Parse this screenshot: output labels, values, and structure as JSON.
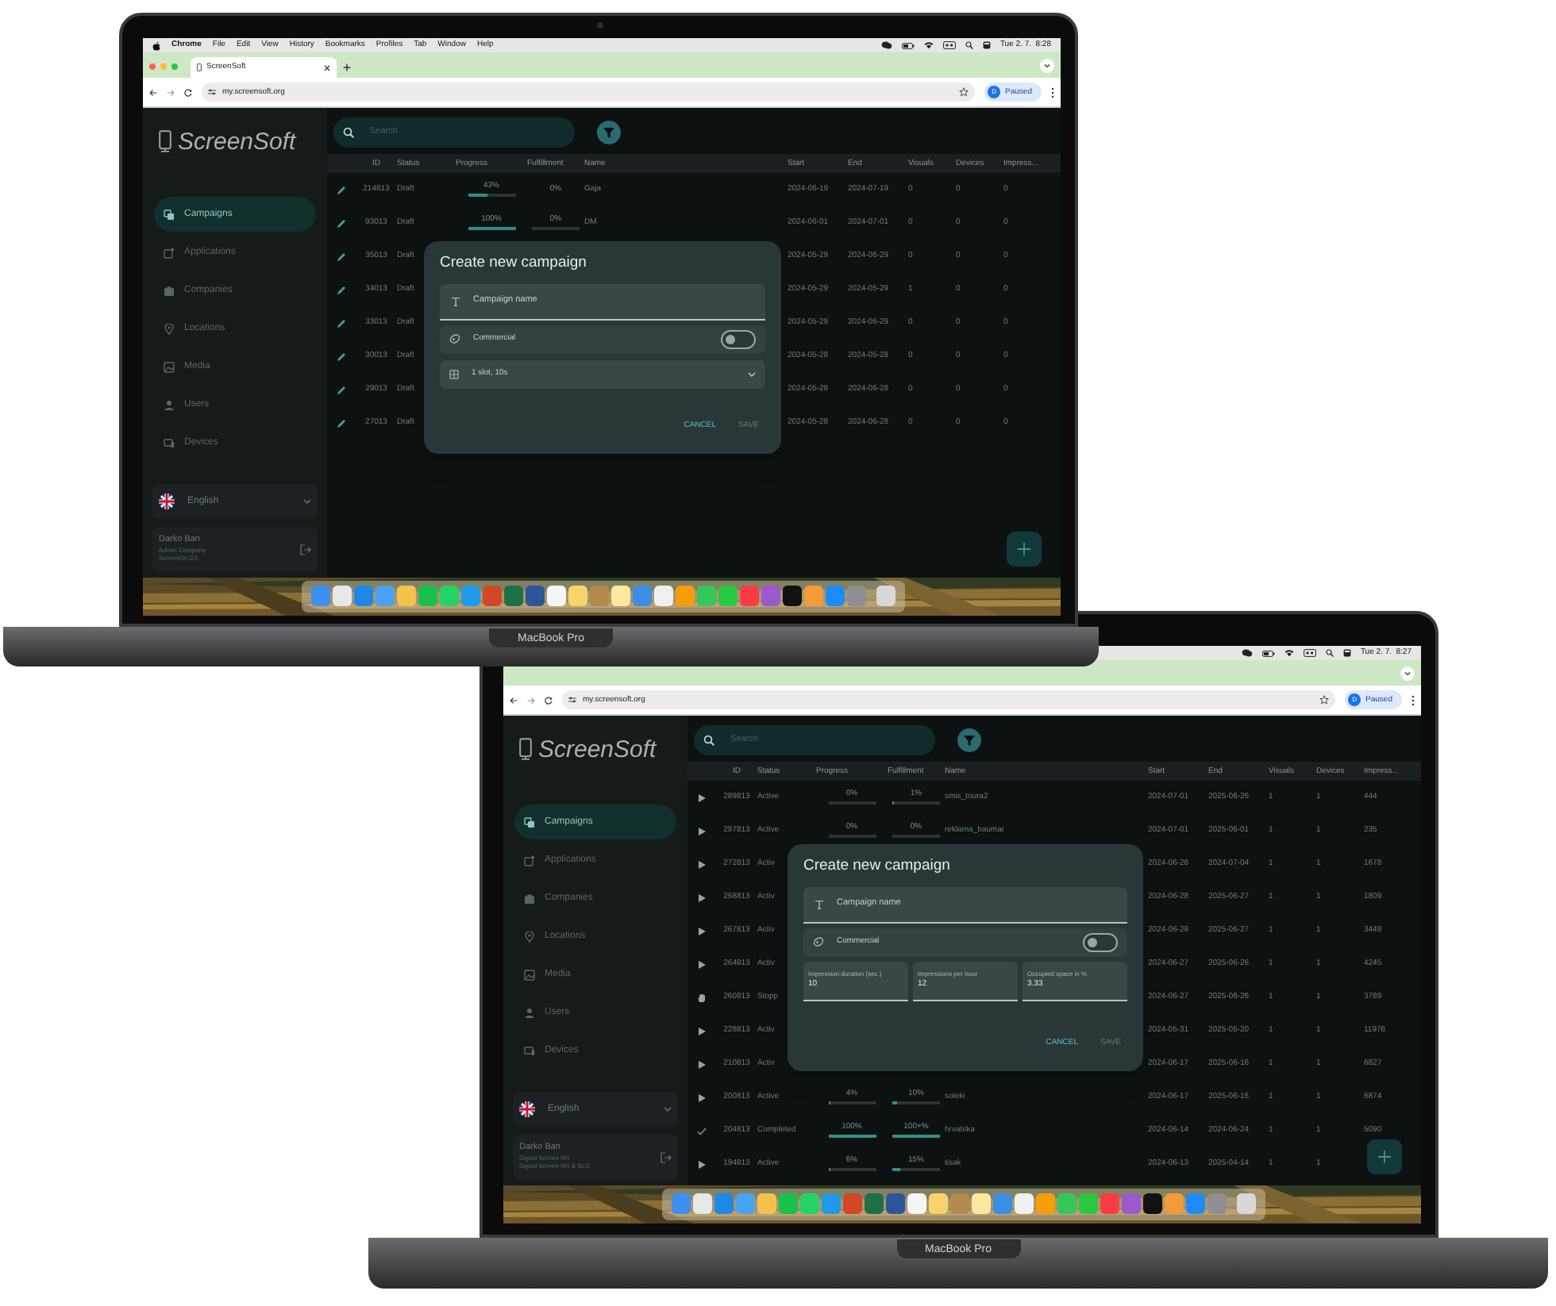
{
  "laptops": [
    {
      "menu_bar": {
        "app_menus": [
          "Chrome",
          "File",
          "Edit",
          "View",
          "History",
          "Bookmarks",
          "Profiles",
          "Tab",
          "Window",
          "Help"
        ],
        "clock": "Tue 2. 7.  8:28"
      },
      "tabs": [
        {
          "title": "ScreenSoft",
          "selected": true
        }
      ],
      "address_bar": {
        "url": "my.screensoft.org",
        "avatar": "D",
        "profile": "Paused"
      },
      "app": {
        "logo": "ScreenSoft",
        "search": {
          "placeholder": "Search"
        },
        "nav": [
          {
            "label": "Campaigns",
            "selected": true
          },
          {
            "label": "Applications",
            "selected": false
          },
          {
            "label": "Companies",
            "selected": false
          },
          {
            "label": "Locations",
            "selected": false
          },
          {
            "label": "Media",
            "selected": false
          },
          {
            "label": "Users",
            "selected": false
          },
          {
            "label": "Devices",
            "selected": false
          }
        ],
        "language": "English",
        "user": {
          "name": "Darko Ban",
          "line_2": "Admin Company",
          "line_3": "ScreenOn CX"
        },
        "table": {
          "columns": [
            "ID",
            "Status",
            "Progress",
            "Fulfillment",
            "Name",
            "Start",
            "End",
            "Visuals",
            "Devices",
            "Impress..."
          ],
          "rows": [
            {
              "kind": "draft",
              "id": "214813",
              "status": "Draft",
              "progress": {
                "text": "43%",
                "level": 0.43
              },
              "fulfillment": {
                "text": "0%"
              },
              "name": "Gaja",
              "start": "2024-06-19",
              "end": "2024-07-19",
              "visuals": "0",
              "devices": "0",
              "impressions": "0"
            },
            {
              "kind": "draft",
              "id": "93013",
              "status": "Draft",
              "progress": {
                "text": "100%",
                "level": 1
              },
              "fulfillment": {
                "text": "0%",
                "level": 0
              },
              "name": "DM",
              "start": "2024-06-01",
              "end": "2024-07-01",
              "visuals": "0",
              "devices": "0",
              "impressions": "0"
            },
            {
              "kind": "draft",
              "id": "35013",
              "status": "Draft",
              "start": "2024-05-29",
              "end": "2024-06-29",
              "visuals": "0",
              "devices": "0",
              "impressions": "0"
            },
            {
              "kind": "draft",
              "id": "34013",
              "status": "Draft",
              "start": "2024-05-29",
              "end": "2024-05-29",
              "visuals": "1",
              "devices": "0",
              "impressions": "0"
            },
            {
              "kind": "draft",
              "id": "33013",
              "status": "Draft",
              "start": "2024-05-29",
              "end": "2024-06-29",
              "visuals": "0",
              "devices": "0",
              "impressions": "0"
            },
            {
              "kind": "draft",
              "id": "30013",
              "status": "Draft",
              "start": "2024-05-28",
              "end": "2024-05-28",
              "visuals": "0",
              "devices": "0",
              "impressions": "0"
            },
            {
              "kind": "draft",
              "id": "29013",
              "status": "Draft",
              "start": "2024-05-28",
              "end": "2024-06-28",
              "visuals": "0",
              "devices": "0",
              "impressions": "0"
            },
            {
              "kind": "draft",
              "id": "27013",
              "status": "Draft",
              "start": "2024-05-28",
              "end": "2024-06-28",
              "visuals": "0",
              "devices": "0",
              "impressions": "0"
            }
          ]
        },
        "dialog": {
          "title": "Create new campaign",
          "name_field": {
            "placeholder": "Campaign name"
          },
          "commercial": {
            "label": "Commercial",
            "on": false
          },
          "select": {
            "value": "1 slot, 10s"
          },
          "buttons": [
            {
              "label": "CANCEL",
              "disabled": false
            },
            {
              "label": "SAVE",
              "disabled": true
            }
          ]
        }
      },
      "device_label": "MacBook Pro"
    },
    {
      "menu_bar": {
        "clock": "Tue 2. 7.  8:27"
      },
      "address_bar": {
        "url": "my.screensoft.org",
        "avatar": "D",
        "profile": "Paused"
      },
      "app": {
        "logo": "ScreenSoft",
        "search": {
          "placeholder": "Search"
        },
        "nav": [
          {
            "label": "Campaigns",
            "selected": true
          },
          {
            "label": "Applications",
            "selected": false
          },
          {
            "label": "Companies",
            "selected": false
          },
          {
            "label": "Locations",
            "selected": false
          },
          {
            "label": "Media",
            "selected": false
          },
          {
            "label": "Users",
            "selected": false
          },
          {
            "label": "Devices",
            "selected": false
          }
        ],
        "language": "English",
        "user": {
          "name": "Darko Ban",
          "line_2": "Digital Screen HR",
          "line_3": "Digital Screen HR & SLO"
        },
        "table": {
          "columns": [
            "ID",
            "Status",
            "Progress",
            "Fulfillment",
            "Name",
            "Start",
            "End",
            "Visuals",
            "Devices",
            "Impress..."
          ],
          "rows": [
            {
              "kind": "active",
              "id": "289813",
              "status": "Active",
              "progress": {
                "text": "0%",
                "level": 0
              },
              "fulfillment": {
                "text": "1%",
                "level": 0.01
              },
              "name": "smis_toura2",
              "start": "2024-07-01",
              "end": "2025-06-26",
              "visuals": "1",
              "devices": "1",
              "impressions": "444"
            },
            {
              "kind": "active",
              "id": "287813",
              "status": "Active",
              "progress": {
                "text": "0%",
                "level": 0
              },
              "fulfillment": {
                "text": "0%",
                "level": 0
              },
              "name": "reklama_baumar",
              "start": "2024-07-01",
              "end": "2025-06-01",
              "visuals": "1",
              "devices": "1",
              "impressions": "235"
            },
            {
              "kind": "active",
              "id": "272813",
              "status": "Activ",
              "start": "2024-06-28",
              "end": "2024-07-04",
              "visuals": "1",
              "devices": "1",
              "impressions": "1678"
            },
            {
              "kind": "active",
              "id": "268813",
              "status": "Activ",
              "start": "2024-06-28",
              "end": "2025-06-27",
              "visuals": "1",
              "devices": "1",
              "impressions": "1809"
            },
            {
              "kind": "active",
              "id": "267813",
              "status": "Activ",
              "start": "2024-06-28",
              "end": "2025-06-27",
              "visuals": "1",
              "devices": "1",
              "impressions": "3448"
            },
            {
              "kind": "active",
              "id": "264813",
              "status": "Activ",
              "start": "2024-06-27",
              "end": "2025-06-26",
              "visuals": "1",
              "devices": "1",
              "impressions": "4245"
            },
            {
              "kind": "stopped",
              "id": "260813",
              "status": "Stopp",
              "start": "2024-06-27",
              "end": "2025-06-26",
              "visuals": "1",
              "devices": "1",
              "impressions": "3789"
            },
            {
              "kind": "active",
              "id": "228813",
              "status": "Activ",
              "start": "2024-05-31",
              "end": "2025-05-20",
              "visuals": "1",
              "devices": "1",
              "impressions": "11976"
            },
            {
              "kind": "active",
              "id": "210813",
              "status": "Activ",
              "start": "2024-06-17",
              "end": "2025-06-16",
              "visuals": "1",
              "devices": "1",
              "impressions": "6827"
            },
            {
              "kind": "active",
              "id": "200813",
              "status": "Active",
              "progress": {
                "text": "4%",
                "level": 0.04
              },
              "fulfillment": {
                "text": "10%",
                "level": 0.1
              },
              "name": "soleki",
              "start": "2024-06-17",
              "end": "2025-06-16",
              "visuals": "1",
              "devices": "1",
              "impressions": "6874"
            },
            {
              "kind": "completed",
              "id": "204813",
              "status": "Completed",
              "progress": {
                "text": "100%",
                "level": 1
              },
              "fulfillment": {
                "text": "100+%",
                "level": 1
              },
              "name": "hrvatska",
              "start": "2024-06-14",
              "end": "2024-06-24",
              "visuals": "1",
              "devices": "1",
              "impressions": "5090"
            },
            {
              "kind": "active",
              "id": "194813",
              "status": "Active",
              "progress": {
                "text": "6%",
                "level": 0.06
              },
              "fulfillment": {
                "text": "15%",
                "level": 0.15
              },
              "name": "tisak",
              "start": "2024-06-13",
              "end": "2025-04-14",
              "visuals": "1",
              "devices": "1"
            }
          ]
        },
        "dialog": {
          "title": "Create new campaign",
          "name_field": {
            "placeholder": "Campaign name"
          },
          "commercial": {
            "label": "Commercial",
            "on": false
          },
          "fields": [
            {
              "label": "Impression duration (sec.)",
              "value": "10"
            },
            {
              "label": "Impressions per hour",
              "value": "12"
            },
            {
              "label": "Occupied space in %",
              "value": "3.33"
            }
          ],
          "buttons": [
            {
              "label": "CANCEL",
              "disabled": false
            },
            {
              "label": "SAVE",
              "disabled": true
            }
          ]
        }
      },
      "device_label": "MacBook Pro"
    }
  ]
}
